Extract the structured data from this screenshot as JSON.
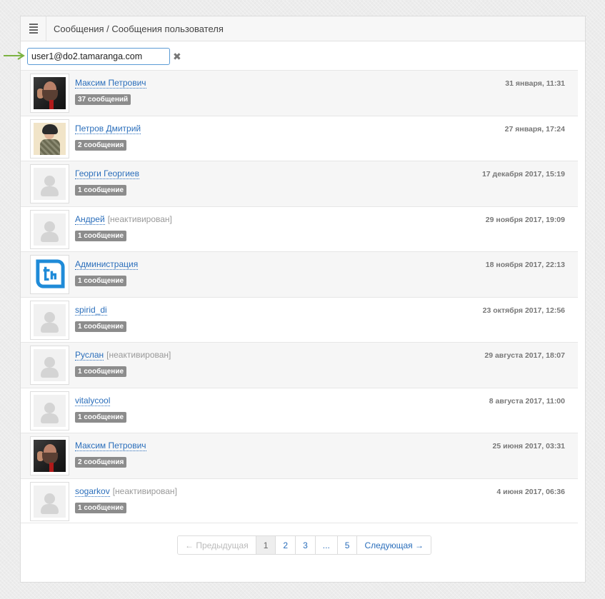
{
  "header": {
    "breadcrumb": "Сообщения / Сообщения пользователя"
  },
  "search": {
    "value": "user1@do2.tamaranga.com"
  },
  "conversations": [
    {
      "name": "Максим Петрович",
      "status": "",
      "count": "37 сообщений",
      "date": "31 января, 11:31",
      "avatar": "photo-man"
    },
    {
      "name": "Петров Дмитрий",
      "status": "",
      "count": "2 сообщения",
      "date": "27 января, 17:24",
      "avatar": "photo-boy"
    },
    {
      "name": "Георги Георгиев",
      "status": "",
      "count": "1 сообщение",
      "date": "17 декабря 2017, 15:19",
      "avatar": "placeholder"
    },
    {
      "name": "Андрей",
      "status": "[неактивирован]",
      "count": "1 сообщение",
      "date": "29 ноября 2017, 19:09",
      "avatar": "placeholder"
    },
    {
      "name": "Администрация",
      "status": "",
      "count": "1 сообщение",
      "date": "18 ноября 2017, 22:13",
      "avatar": "logo"
    },
    {
      "name": "spirid_di",
      "status": "",
      "count": "1 сообщение",
      "date": "23 октября 2017, 12:56",
      "avatar": "placeholder"
    },
    {
      "name": "Руслан",
      "status": "[неактивирован]",
      "count": "1 сообщение",
      "date": "29 августа 2017, 18:07",
      "avatar": "placeholder"
    },
    {
      "name": "vitalycool",
      "status": "",
      "count": "1 сообщение",
      "date": "8 августа 2017, 11:00",
      "avatar": "placeholder"
    },
    {
      "name": "Максим Петрович",
      "status": "",
      "count": "2 сообщения",
      "date": "25 июня 2017, 03:31",
      "avatar": "photo-man"
    },
    {
      "name": "sogarkov",
      "status": "[неактивирован]",
      "count": "1 сообщение",
      "date": "4 июня 2017, 06:36",
      "avatar": "placeholder"
    }
  ],
  "pagination": {
    "prev": "← Предыдущая",
    "pages": [
      "1",
      "2",
      "3",
      "...",
      "5"
    ],
    "current": "1",
    "next": "Следующая →"
  },
  "colors": {
    "link": "#2a6ebb",
    "badge": "#8c8c8c",
    "arrow": "#7cb342",
    "logo": "#1f8bd8"
  }
}
